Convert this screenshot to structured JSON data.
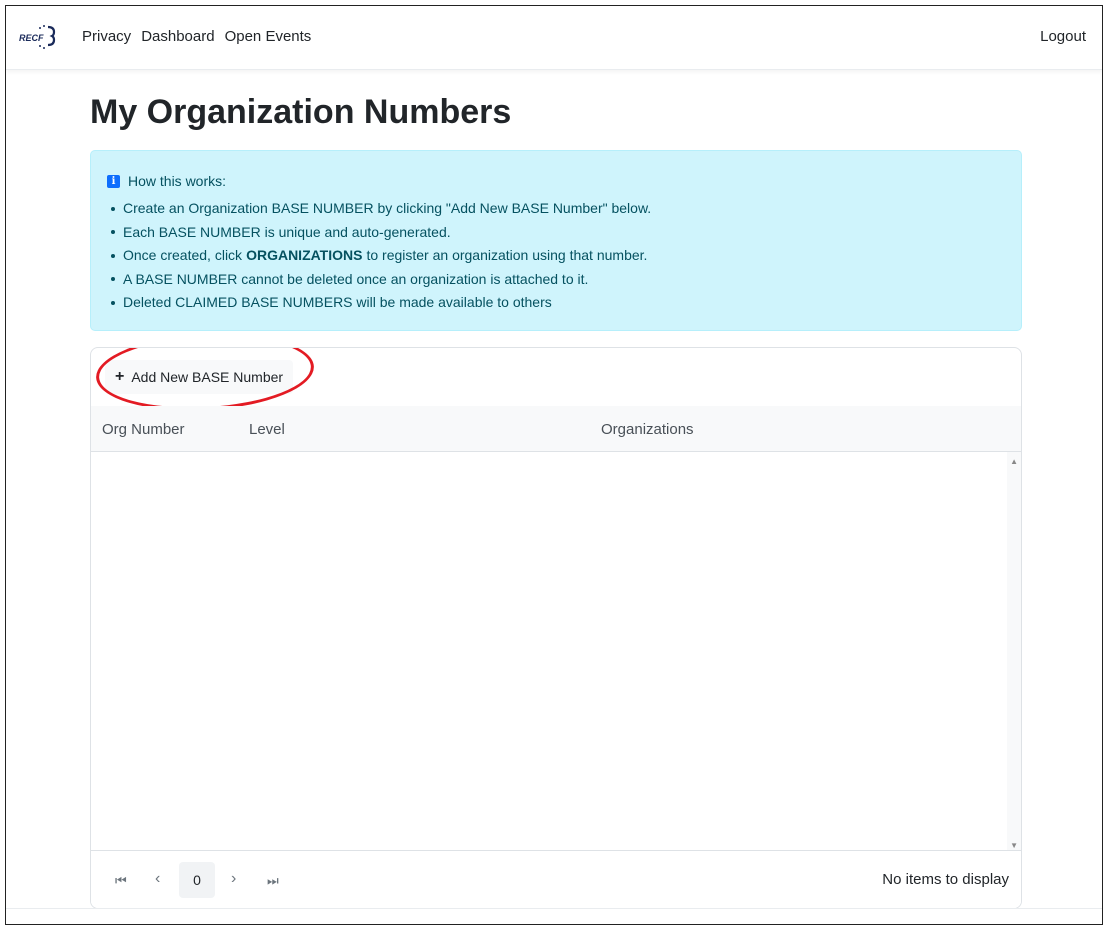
{
  "nav": {
    "logo_text": "RECF",
    "links": [
      "Privacy",
      "Dashboard",
      "Open Events"
    ],
    "logout": "Logout"
  },
  "page": {
    "title": "My Organization Numbers"
  },
  "info": {
    "heading": "How this works:",
    "items": [
      {
        "before": "Create an Organization BASE NUMBER by clicking \"Add New BASE Number\" below.",
        "bold": "",
        "after": ""
      },
      {
        "before": "Each BASE NUMBER is unique and auto-generated.",
        "bold": "",
        "after": ""
      },
      {
        "before": "Once created, click",
        "bold": "ORGANIZATIONS",
        "after": "to register an organization using that number."
      },
      {
        "before": "A BASE NUMBER cannot be deleted once an organization is attached to it.",
        "bold": "",
        "after": ""
      },
      {
        "before": "Deleted CLAIMED BASE NUMBERS will be made available to others",
        "bold": "",
        "after": ""
      }
    ],
    "icon": "info-icon",
    "colors": {
      "background": "#cff4fc",
      "text": "#055160",
      "icon": "#0d6efd"
    }
  },
  "grid": {
    "add_button_label": "Add New BASE Number",
    "columns": [
      "Org Number",
      "Level",
      "Organizations"
    ],
    "rows": [],
    "pager": {
      "first": "⏮",
      "prev": "‹",
      "page": "0",
      "next": "›",
      "last": "⏭",
      "status": "No items to display"
    },
    "annotation_color": "#e31b23"
  }
}
